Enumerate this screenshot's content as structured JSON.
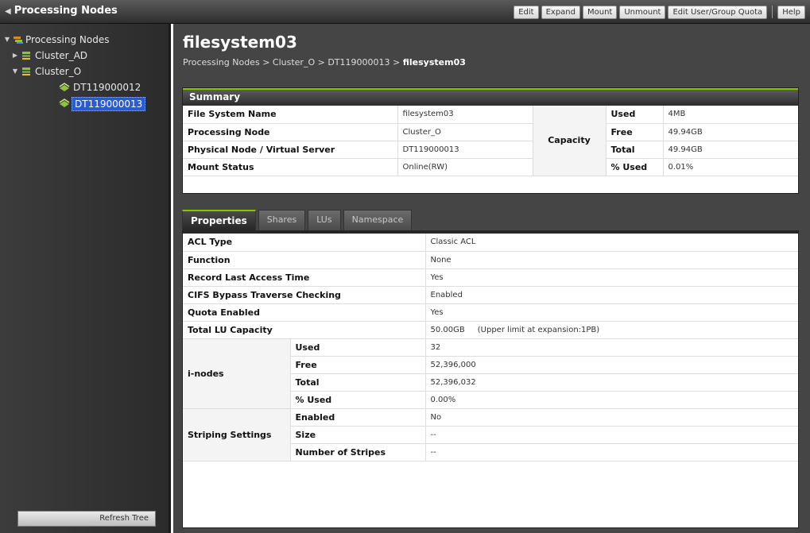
{
  "header": {
    "title": "Processing Nodes",
    "toolbar": {
      "edit": "Edit",
      "expand": "Expand",
      "mount": "Mount",
      "unmount": "Unmount",
      "quota": "Edit User/Group Quota",
      "help": "Help"
    }
  },
  "tree": {
    "root": "Processing Nodes",
    "cluster_ad": "Cluster_AD",
    "cluster_o": "Cluster_O",
    "node1": "DT119000012",
    "node2": "DT119000013",
    "refresh": "Refresh Tree"
  },
  "page": {
    "title": "filesystem03",
    "breadcrumb": {
      "crumb1": "Processing Nodes",
      "crumb2": "Cluster_O",
      "crumb3": "DT119000013",
      "current": "filesystem03",
      "sep": ">"
    }
  },
  "summary": {
    "heading": "Summary",
    "rows": [
      {
        "label": "File System Name",
        "value": "filesystem03"
      },
      {
        "label": "Processing Node",
        "value": "Cluster_O"
      },
      {
        "label": "Physical Node / Virtual Server",
        "value": "DT119000013"
      },
      {
        "label": "Mount Status",
        "value": "Online(RW)"
      }
    ],
    "capacity_label": "Capacity",
    "capacity": [
      {
        "label": "Used",
        "value": "4MB"
      },
      {
        "label": "Free",
        "value": "49.94GB"
      },
      {
        "label": "Total",
        "value": "49.94GB"
      },
      {
        "label": "% Used",
        "value": "0.01%"
      }
    ]
  },
  "tabs": [
    "Properties",
    "Shares",
    "LUs",
    "Namespace"
  ],
  "properties": {
    "rows": [
      {
        "label": "ACL Type",
        "value": "Classic ACL"
      },
      {
        "label": "Function",
        "value": "None"
      },
      {
        "label": "Record Last Access Time",
        "value": "Yes"
      },
      {
        "label": "CIFS Bypass Traverse Checking",
        "value": "Enabled"
      },
      {
        "label": "Quota Enabled",
        "value": "Yes"
      },
      {
        "label": "Total LU Capacity",
        "value": "50.00GB",
        "note": "(Upper limit at expansion:1PB)"
      }
    ],
    "inodes": {
      "label": "i-nodes",
      "rows": [
        {
          "label": "Used",
          "value": "32"
        },
        {
          "label": "Free",
          "value": "52,396,000"
        },
        {
          "label": "Total",
          "value": "52,396,032"
        },
        {
          "label": "% Used",
          "value": "0.00%"
        }
      ]
    },
    "striping": {
      "label": "Striping Settings",
      "rows": [
        {
          "label": "Enabled",
          "value": "No"
        },
        {
          "label": "Size",
          "value": "--"
        },
        {
          "label": "Number of Stripes",
          "value": "--"
        }
      ]
    }
  }
}
